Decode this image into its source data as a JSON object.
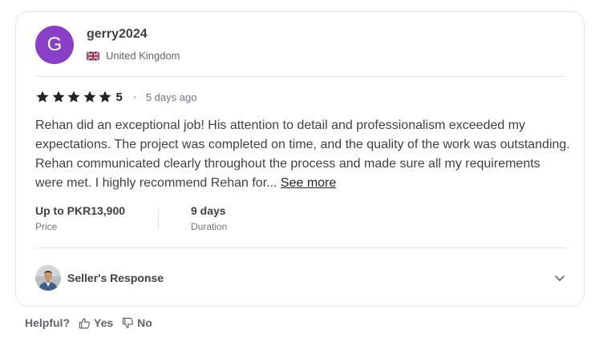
{
  "reviewer": {
    "avatar_letter": "G",
    "avatar_color": "#8a3fc7",
    "username": "gerry2024",
    "country": "United Kingdom",
    "flag_icon": "uk-flag-icon"
  },
  "rating": {
    "stars": 5,
    "value": "5",
    "time_ago": "5 days ago",
    "star_color": "#222325"
  },
  "review": {
    "text": "Rehan did an exceptional job! His attention to detail and professionalism exceeded my expectations. The project was completed on time, and the quality of the work was outstanding. Rehan communicated clearly throughout the process and made sure all my requirements were met. I highly recommend Rehan for...",
    "see_more_label": "See more"
  },
  "stats": {
    "price_value": "Up to PKR13,900",
    "price_label": "Price",
    "duration_value": "9 days",
    "duration_label": "Duration"
  },
  "seller_response": {
    "label": "Seller's Response",
    "expand_icon": "chevron-down-icon"
  },
  "helpful": {
    "label": "Helpful?",
    "yes_label": "Yes",
    "no_label": "No",
    "yes_icon": "thumbs-up-icon",
    "no_icon": "thumbs-down-icon"
  }
}
